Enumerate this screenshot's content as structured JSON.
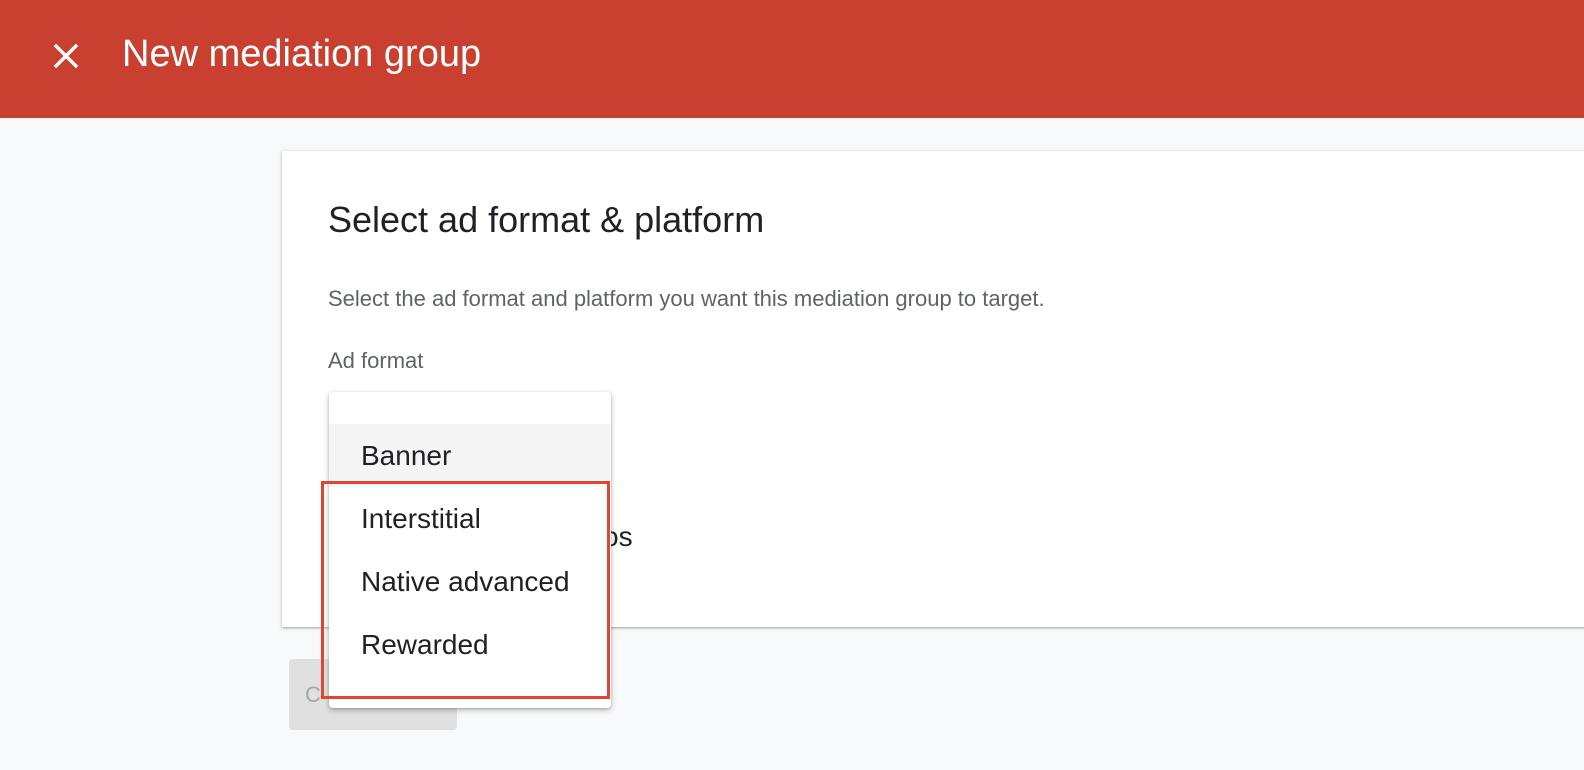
{
  "header": {
    "title": "New mediation group",
    "close_icon": "close-icon",
    "background_color": "#c94031"
  },
  "card": {
    "title": "Select ad format & platform",
    "description": "Select the ad format and platform you want this mediation group to target.",
    "ad_format_label": "Ad format",
    "platform_partial": "os"
  },
  "dropdown": {
    "options": [
      {
        "label": "Banner",
        "hovered": true
      },
      {
        "label": "Interstitial",
        "hovered": false
      },
      {
        "label": "Native advanced",
        "hovered": false
      },
      {
        "label": "Rewarded",
        "hovered": false
      }
    ],
    "highlight_color": "#e2452f"
  },
  "footer": {
    "continue_label": "C"
  }
}
